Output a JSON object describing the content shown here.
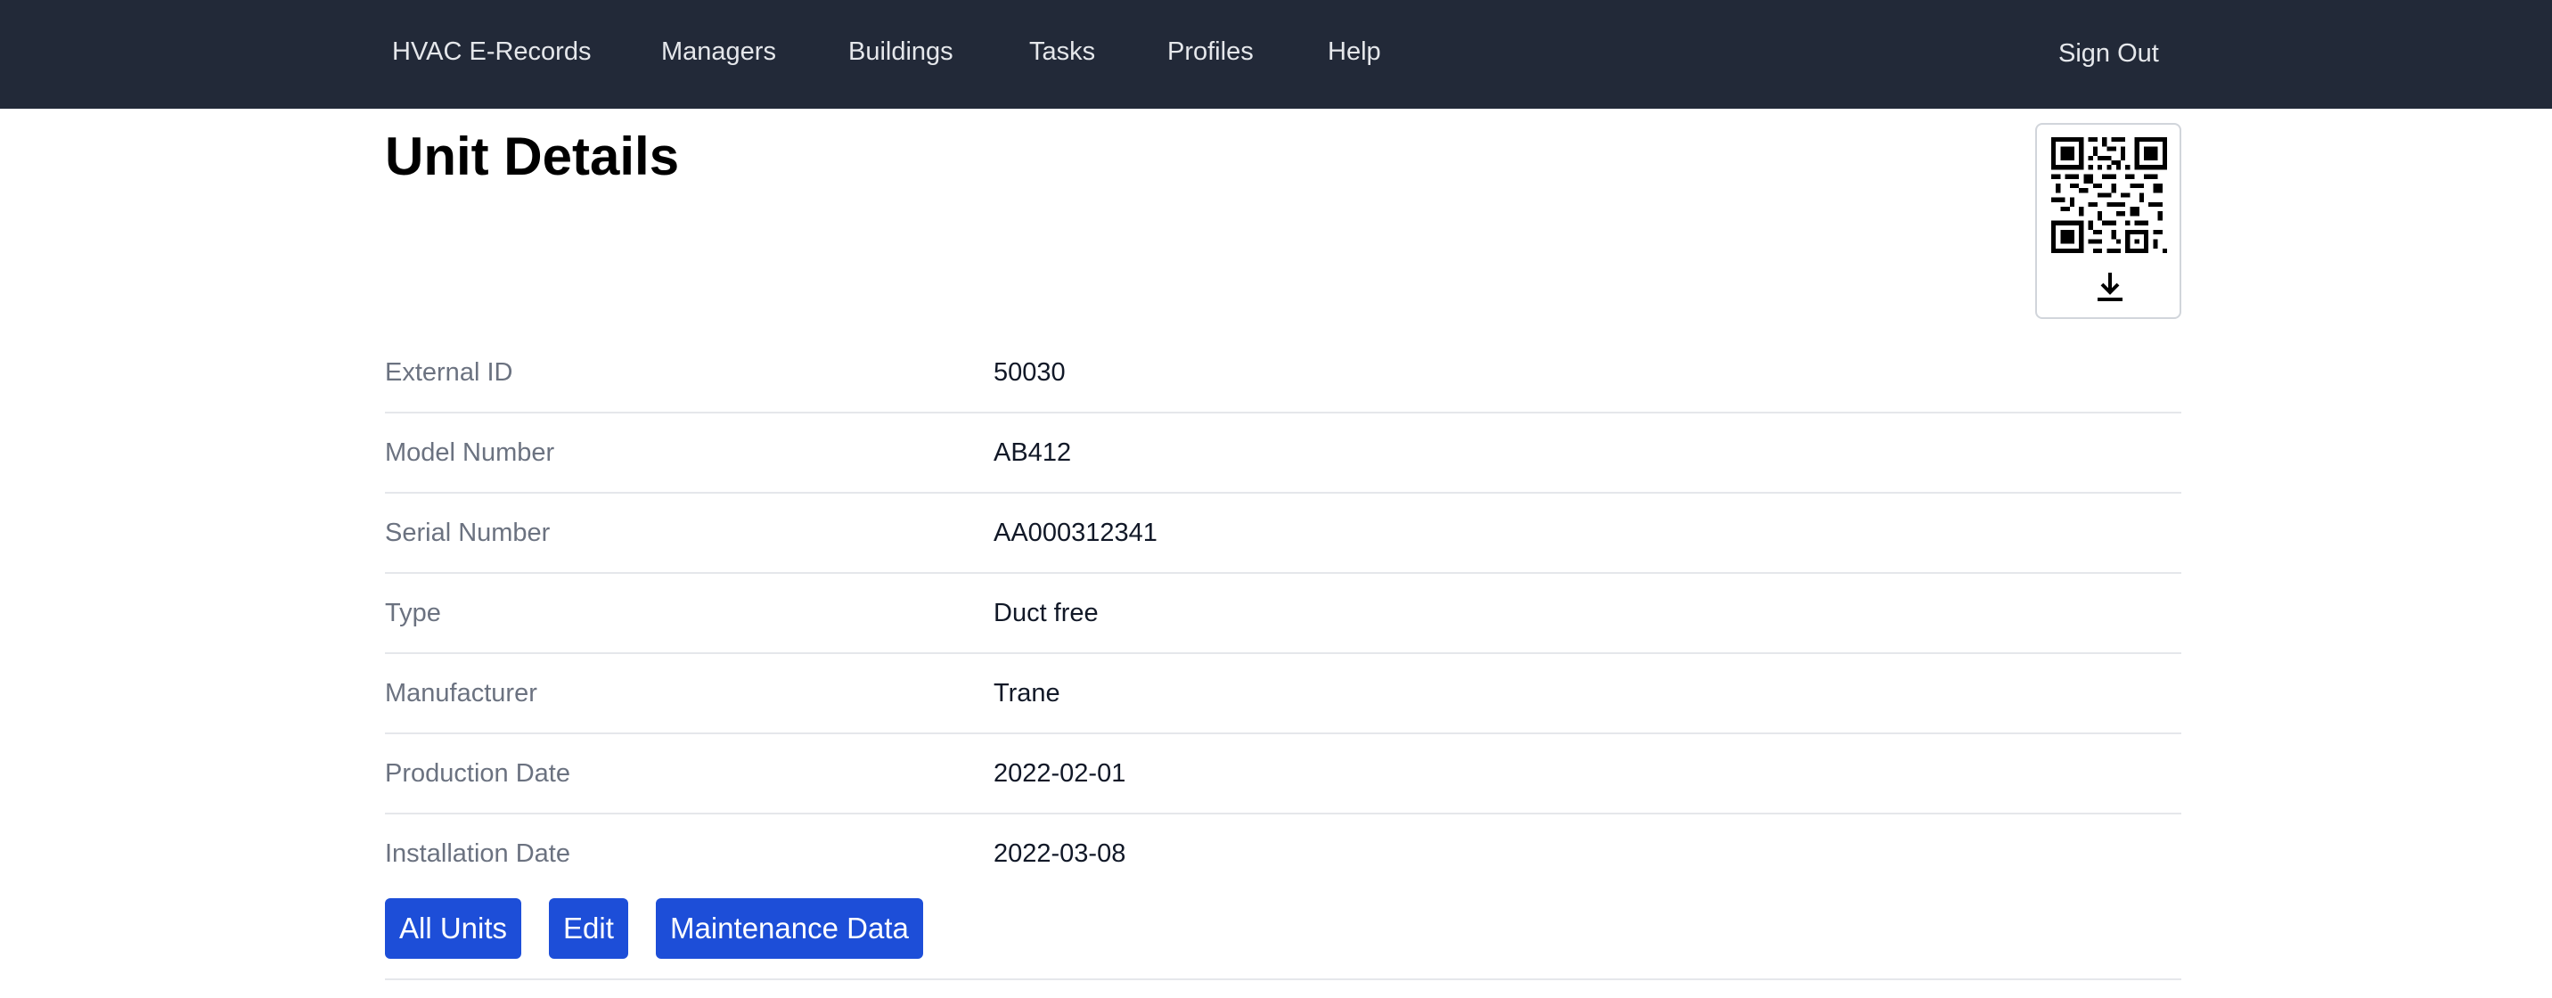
{
  "nav": {
    "brand": "HVAC E-Records",
    "links": [
      "Managers",
      "Buildings",
      "Tasks",
      "Profiles",
      "Help"
    ],
    "sign_out": "Sign Out"
  },
  "page": {
    "title": "Unit Details"
  },
  "qr": {
    "icon": "qr-code-icon",
    "download_icon": "download-icon"
  },
  "details": [
    {
      "label": "External ID",
      "value": "50030"
    },
    {
      "label": "Model Number",
      "value": "AB412"
    },
    {
      "label": "Serial Number",
      "value": "AA000312341"
    },
    {
      "label": "Type",
      "value": "Duct free"
    },
    {
      "label": "Manufacturer",
      "value": "Trane"
    },
    {
      "label": "Production Date",
      "value": "2022-02-01"
    },
    {
      "label": "Installation Date",
      "value": "2022-03-08"
    }
  ],
  "actions": {
    "all_units": "All Units",
    "edit": "Edit",
    "maintenance": "Maintenance Data"
  },
  "colors": {
    "navbar": "#222938",
    "primary_button": "#1d4ed8",
    "label_text": "#6b7280"
  }
}
